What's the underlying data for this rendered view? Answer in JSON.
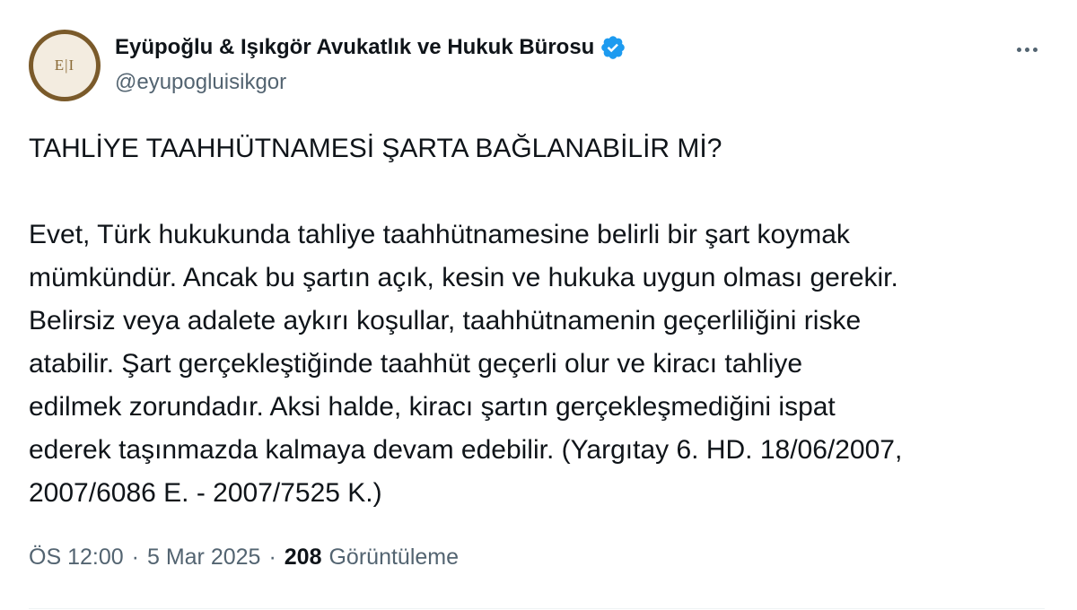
{
  "author": {
    "name": "Eyüpoğlu & Işıkgör Avukatlık ve Hukuk Bürosu",
    "handle": "@eyupogluisikgor",
    "avatar_text": "E|I",
    "verified": true
  },
  "tweet": {
    "title": "TAHLİYE TAAHHÜTNAMESİ ŞARTA BAĞLANABİLİR Mİ?",
    "lines": [
      "Evet, Türk hukukunda tahliye taahhütnamesine belirli bir şart koymak",
      "mümkündür. Ancak bu şartın açık, kesin ve hukuka uygun olması gerekir.",
      "Belirsiz veya adalete aykırı koşullar, taahhütnamenin geçerliliğini riske",
      "atabilir. Şart gerçekleştiğinde taahhüt geçerli olur ve kiracı tahliye",
      "edilmek zorundadır. Aksi halde, kiracı şartın gerçekleşmediğini ispat",
      "ederek taşınmazda kalmaya devam edebilir. (Yargıtay 6. HD. 18/06/2007,",
      "2007/6086 E. - 2007/7525 K.)"
    ]
  },
  "meta": {
    "time": "ÖS 12:00",
    "separator": "·",
    "date": "5 Mar 2025",
    "views_count": "208",
    "views_label": "Görüntüleme"
  },
  "icons": {
    "more": "more-horizontal-icon",
    "verified": "verified-badge-icon"
  },
  "colors": {
    "text": "#0f1419",
    "secondary": "#536471",
    "verified": "#1d9bf0",
    "avatar_ring": "#7a5a2a"
  }
}
